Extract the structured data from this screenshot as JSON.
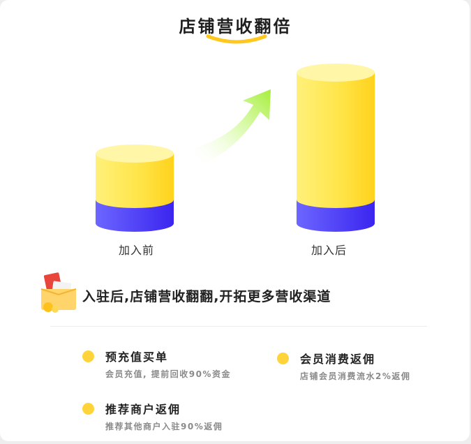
{
  "title": "店铺营收翻倍",
  "chart": {
    "before_label": "加入前",
    "after_label": "加入后"
  },
  "headline": "入驻后,店铺营收翻翻,开拓更多营收渠道",
  "benefits": [
    {
      "title": "预充值买单",
      "desc": "会员充值, 提前回收90%资金"
    },
    {
      "title": "会员消费返佣",
      "desc": "店铺会员消费流水2%返佣"
    },
    {
      "title": "推荐商户返佣",
      "desc": "推荐其他商户入驻90%返佣"
    }
  ],
  "colors": {
    "yellow": "#ffd43b",
    "blue": "#4b3df2",
    "arrow_green": "#a6ee3c"
  }
}
